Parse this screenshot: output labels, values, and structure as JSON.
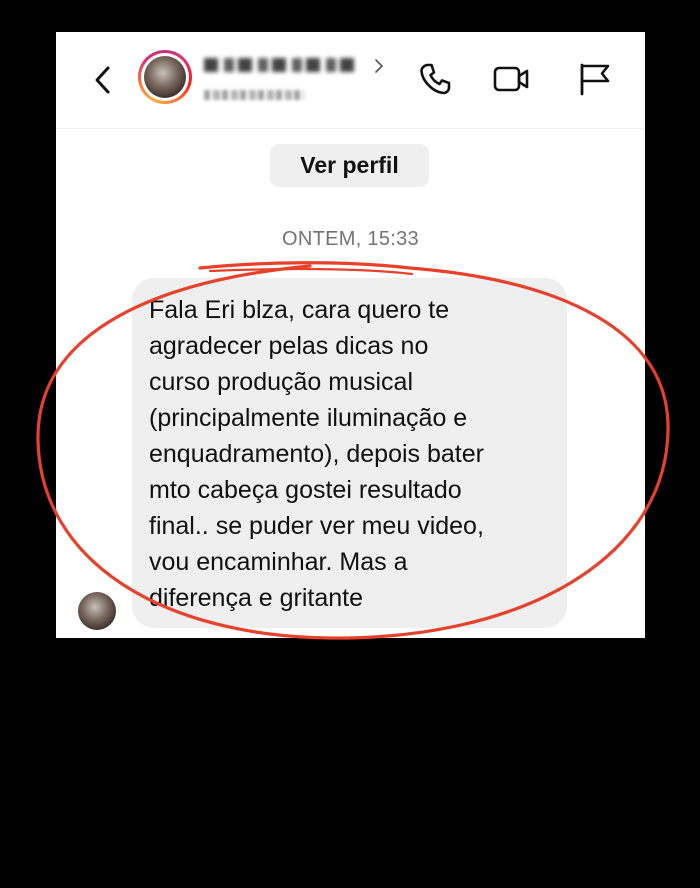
{
  "header": {
    "username": "",
    "handle": "",
    "icons": [
      "back-chevron-icon",
      "phone-icon",
      "video-camera-icon",
      "flag-icon"
    ]
  },
  "profile_button_label": "Ver perfil",
  "conversation": {
    "timestamp": "ONTEM, 15:33",
    "messages": [
      {
        "text": "Fala Eri blza, cara quero te\nagradecer pelas dicas no\ncurso produção musical\n(principalmente iluminação e\nenquadramento), depois bater\nmto cabeça gostei resultado\nfinal.. se puder ver meu video,\nvou encaminhar. Mas a\ndiferença e gritante"
      }
    ]
  },
  "colors": {
    "annotation": "#e8402a",
    "bubble": "#efefef",
    "text": "#111111",
    "muted": "#737373"
  }
}
